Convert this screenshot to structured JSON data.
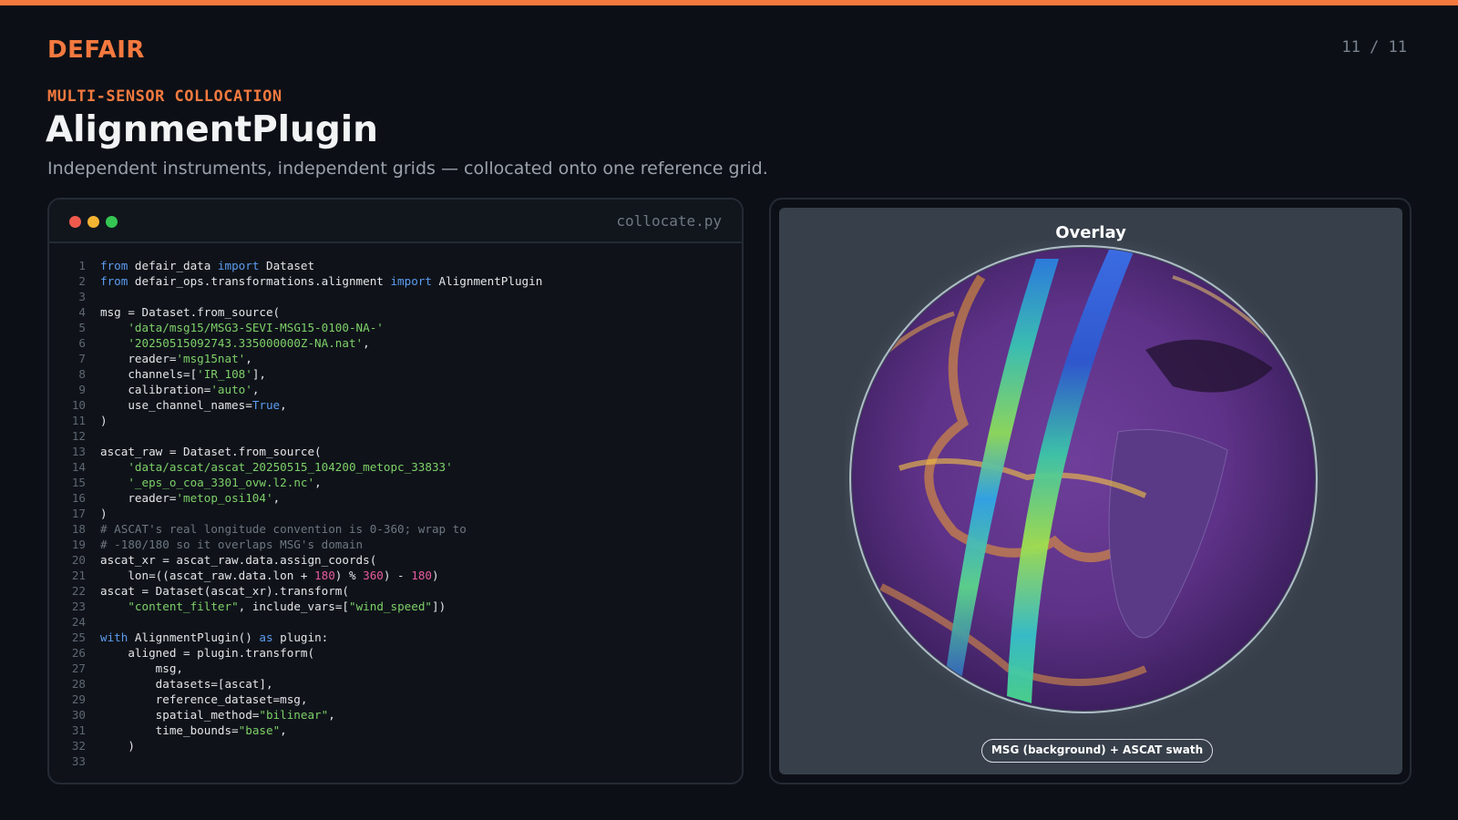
{
  "header": {
    "brand": "DEFAIR",
    "page_indicator": "11 / 11",
    "kicker": "MULTI-SENSOR COLLOCATION",
    "title": "AlignmentPlugin",
    "subtitle": "Independent instruments, independent grids — collocated onto one reference grid."
  },
  "editor": {
    "filename": "collocate.py",
    "lines": [
      [
        [
          "kw",
          "from"
        ],
        [
          "pl",
          " defair_data "
        ],
        [
          "kw",
          "import"
        ],
        [
          "pl",
          " Dataset"
        ]
      ],
      [
        [
          "kw",
          "from"
        ],
        [
          "pl",
          " defair_ops.transformations.alignment "
        ],
        [
          "kw",
          "import"
        ],
        [
          "pl",
          " AlignmentPlugin"
        ]
      ],
      [],
      [
        [
          "pl",
          "msg = Dataset.from_source("
        ]
      ],
      [
        [
          "pl",
          "    "
        ],
        [
          "str",
          "'data/msg15/MSG3-SEVI-MSG15-0100-NA-'"
        ]
      ],
      [
        [
          "pl",
          "    "
        ],
        [
          "str",
          "'20250515092743.335000000Z-NA.nat'"
        ],
        [
          "pl",
          ","
        ]
      ],
      [
        [
          "pl",
          "    reader="
        ],
        [
          "str",
          "'msg15nat'"
        ],
        [
          "pl",
          ","
        ]
      ],
      [
        [
          "pl",
          "    channels=["
        ],
        [
          "str",
          "'IR_108'"
        ],
        [
          "pl",
          "],"
        ]
      ],
      [
        [
          "pl",
          "    calibration="
        ],
        [
          "str",
          "'auto'"
        ],
        [
          "pl",
          ","
        ]
      ],
      [
        [
          "pl",
          "    use_channel_names="
        ],
        [
          "kw",
          "True"
        ],
        [
          "pl",
          ","
        ]
      ],
      [
        [
          "pl",
          ")"
        ]
      ],
      [],
      [
        [
          "pl",
          "ascat_raw = Dataset.from_source("
        ]
      ],
      [
        [
          "pl",
          "    "
        ],
        [
          "str",
          "'data/ascat/ascat_20250515_104200_metopc_33833'"
        ]
      ],
      [
        [
          "pl",
          "    "
        ],
        [
          "str",
          "'_eps_o_coa_3301_ovw.l2.nc'"
        ],
        [
          "pl",
          ","
        ]
      ],
      [
        [
          "pl",
          "    reader="
        ],
        [
          "str",
          "'metop_osi104'"
        ],
        [
          "pl",
          ","
        ]
      ],
      [
        [
          "pl",
          ")"
        ]
      ],
      [
        [
          "com",
          "# ASCAT's real longitude convention is 0-360; wrap to"
        ]
      ],
      [
        [
          "com",
          "# -180/180 so it overlaps MSG's domain"
        ]
      ],
      [
        [
          "pl",
          "ascat_xr = ascat_raw.data.assign_coords("
        ]
      ],
      [
        [
          "pl",
          "    lon=((ascat_raw.data.lon + "
        ],
        [
          "num",
          "180"
        ],
        [
          "pl",
          ") % "
        ],
        [
          "num",
          "360"
        ],
        [
          "pl",
          ") - "
        ],
        [
          "num",
          "180"
        ],
        [
          "pl",
          ")"
        ]
      ],
      [
        [
          "pl",
          "ascat = Dataset(ascat_xr).transform("
        ]
      ],
      [
        [
          "pl",
          "    "
        ],
        [
          "str",
          "\"content_filter\""
        ],
        [
          "pl",
          ", include_vars=["
        ],
        [
          "str",
          "\"wind_speed\""
        ],
        [
          "pl",
          "])"
        ]
      ],
      [],
      [
        [
          "kw",
          "with"
        ],
        [
          "pl",
          " AlignmentPlugin() "
        ],
        [
          "kw",
          "as"
        ],
        [
          "pl",
          " plugin:"
        ]
      ],
      [
        [
          "pl",
          "    aligned = plugin.transform("
        ]
      ],
      [
        [
          "pl",
          "        msg,"
        ]
      ],
      [
        [
          "pl",
          "        datasets=[ascat],"
        ]
      ],
      [
        [
          "pl",
          "        reference_dataset=msg,"
        ]
      ],
      [
        [
          "pl",
          "        spatial_method="
        ],
        [
          "str",
          "\"bilinear\""
        ],
        [
          "pl",
          ","
        ]
      ],
      [
        [
          "pl",
          "        time_bounds="
        ],
        [
          "str",
          "\"base\""
        ],
        [
          "pl",
          ","
        ]
      ],
      [
        [
          "pl",
          "    )"
        ]
      ],
      []
    ]
  },
  "figure": {
    "title": "Overlay",
    "caption": "MSG (background) + ASCAT swath"
  }
}
